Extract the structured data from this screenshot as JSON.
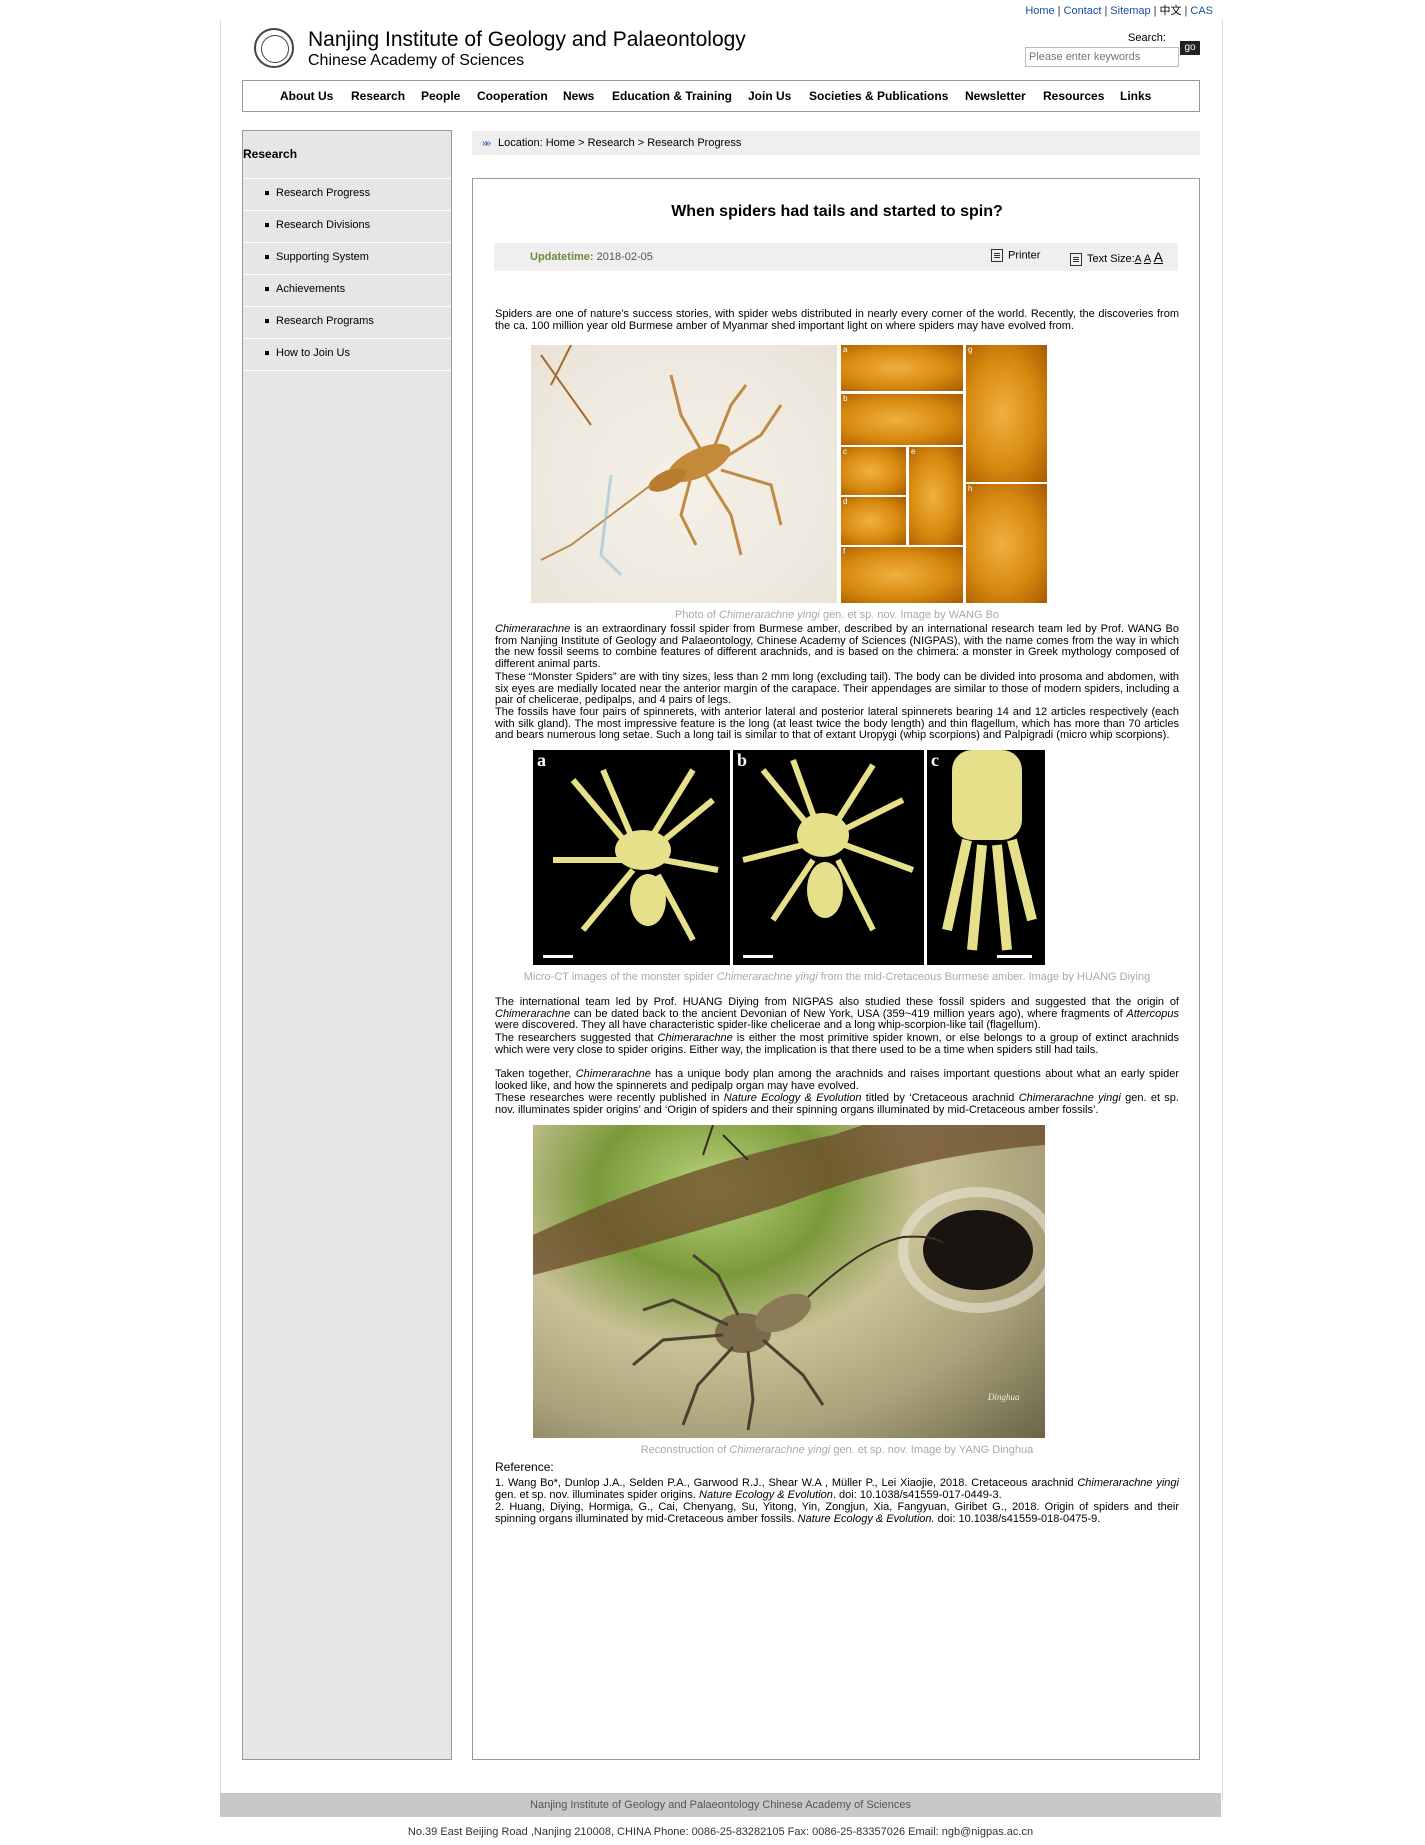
{
  "toplinks": {
    "home": "Home",
    "contact": "Contact",
    "sitemap": "Sitemap",
    "chinese": "中文",
    "cas": "CAS"
  },
  "header": {
    "title": "Nanjing Institute of Geology and Palaeontology",
    "subtitle": "Chinese Academy of Sciences"
  },
  "search": {
    "label": "Search:",
    "placeholder": "Please enter keywords",
    "button": "go"
  },
  "nav": [
    "About Us",
    "Research",
    "People",
    "Cooperation",
    "News",
    "Education & Training",
    "Join Us",
    "Societies & Publications",
    "Newsletter",
    "Resources",
    "Links"
  ],
  "sidebar": {
    "title": "Research",
    "items": [
      "Research Progress",
      "Research Divisions",
      "Supporting System",
      "Achievements",
      "Research Programs",
      "How to Join Us"
    ]
  },
  "breadcrumb": "Location: Home > Research > Research Progress",
  "article": {
    "title": "When spiders had tails and started to spin?",
    "updatetime_label": "Updatetime:",
    "updatetime": "2018-02-05",
    "printer": "Printer",
    "textsize": "Text Size:",
    "ts_small": "A",
    "ts_mid": "A",
    "ts_large": "A",
    "p1": "Spiders are one of nature’s success stories, with spider webs distributed in nearly every corner of the world. Recently, the discoveries from the ca. 100 million year old Burmese amber of Myanmar shed important light on where spiders may have evolved from.",
    "cap1_pre": "Photo of ",
    "cap1_em": "Chimerarachne yingi",
    "cap1_post": " gen. et sp. nov. Image by WANG Bo",
    "p2_em": "Chimerarachne",
    "p2": " is an extraordinary fossil spider from Burmese amber, described by an international research team led by Prof. WANG Bo from Nanjing Institute of Geology and Palaeontology, Chinese Academy of Sciences (NIGPAS), with the name comes from the way in which the new fossil seems to combine features of different arachnids, and is based on the chimera: a monster in Greek mythology composed of different animal parts.",
    "p3": "These “Monster Spiders” are with tiny sizes, less than 2 mm long (excluding tail). The body can be divided into prosoma and abdomen, with six eyes are medially located near the anterior margin of the carapace. Their appendages are similar to those of modern spiders, including a pair of chelicerae, pedipalps, and 4 pairs of legs.",
    "p4": "The fossils have four pairs of spinnerets, with anterior lateral and posterior lateral spinnerets bearing 14 and 12 articles respectively (each with silk gland). The most impressive feature is the long (at least twice the body length) and thin flagellum, which has more than 70 articles and bears numerous long setae. Such a long tail is similar to that of extant Uropygi (whip scorpions) and Palpigradi (micro whip scorpions).",
    "cap2_pre": "Micro-CT images of the monster spider ",
    "cap2_em": "Chimerarachne yingi",
    "cap2_post": " from the mid-Cretaceous Burmese amber. Image by HUANG Diying",
    "p5_a": "The international team led by Prof. HUANG Diying from NIGPAS also studied these fossil spiders and suggested that the origin of ",
    "p5_em1": "Chimerarachne",
    "p5_b": " can be dated back to the ancient Devonian of New York, USA (359~419 million years ago), where fragments of ",
    "p5_em2": "Attercopus",
    "p5_c": " were discovered. They all have characteristic spider-like chelicerae and a long whip-scorpion-like tail (flagellum).",
    "p6_a": "The researchers suggested that ",
    "p6_em": "Chimerarachne",
    "p6_b": " is either the most primitive spider known, or else belongs to a group of extinct arachnids which were very close to spider origins. Either way, the implication is that there used to be a time when spiders still had tails.",
    "p7_a": "Taken together, ",
    "p7_em": "Chimerarachne",
    "p7_b": " has a unique body plan among the arachnids and raises important questions about what an early spider looked like, and how the spinnerets and pedipalp organ may have evolved.",
    "p8_a": "These researches were recently published in ",
    "p8_em1": "Nature Ecology & Evolution",
    "p8_b": " titled by ‘Cretaceous arachnid ",
    "p8_em2": "Chimerarachne yingi",
    "p8_c": " gen. et sp. nov. illuminates spider origins’ and ‘Origin of spiders and their spinning organs illuminated by mid-Cretaceous amber fossils’.",
    "cap3_pre": "Reconstruction of ",
    "cap3_em": "Chimerarachne yingi",
    "cap3_post": " gen. et sp. nov. Image by YANG Dinghua",
    "ref_label": "Reference:",
    "ref1_a": "1. Wang Bo*, Dunlop J.A., Selden P.A., Garwood R.J., Shear W.A , Müller P., Lei Xiaojie, 2018. Cretaceous arachnid ",
    "ref1_em1": "Chimerarachne yingi",
    "ref1_b": " gen. et sp. nov. illuminates spider origins. ",
    "ref1_em2": "Nature Ecology & Evolution",
    "ref1_c": ". doi: 10.1038/s41559-017-0449-3.",
    "ref2_a": "2. Huang, Diying, Hormiga, G., Cai, Chenyang, Su, Yitong, Yin, Zongjun, Xia, Fangyuan, Giribet G., 2018. Origin of spiders and their spinning organs illuminated by mid-Cretaceous amber fossils. ",
    "ref2_em": "Nature Ecology & Evolution.",
    "ref2_b": " doi: 10.1038/s41559-018-0475-9.",
    "fig1_labels": [
      "a",
      "b",
      "c",
      "d",
      "e",
      "f",
      "g",
      "h"
    ],
    "fig2_labels": [
      "a",
      "b",
      "c"
    ],
    "signature": "Dinghua"
  },
  "footer": {
    "org": "Nanjing Institute of Geology and Palaeontology Chinese Academy of Sciences",
    "address": "No.39 East Beijing Road ,Nanjing 210008, CHINA Phone: 0086-25-83282105 Fax: 0086-25-83357026 Email: ngb@nigpas.ac.cn"
  }
}
